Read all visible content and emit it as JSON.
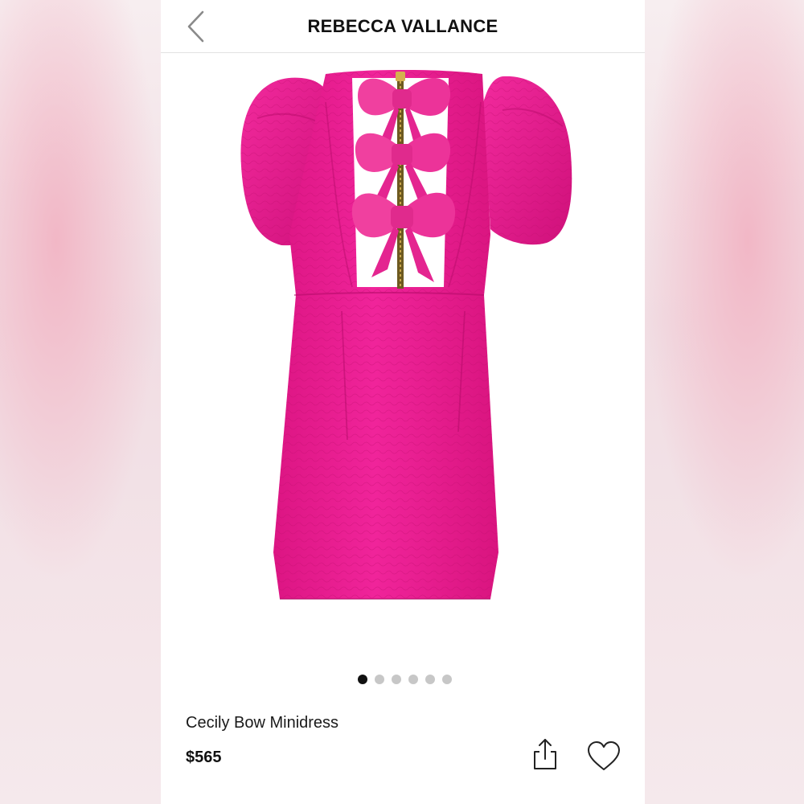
{
  "header": {
    "brand": "REBECCA VALLANCE",
    "back_icon": "chevron-left-icon"
  },
  "gallery": {
    "image_count": 6,
    "active_index": 0,
    "product_color": "#ec1c8e"
  },
  "product": {
    "name": "Cecily Bow Minidress",
    "price": "$565"
  },
  "actions": {
    "share_icon": "share-icon",
    "wishlist_icon": "heart-icon"
  }
}
